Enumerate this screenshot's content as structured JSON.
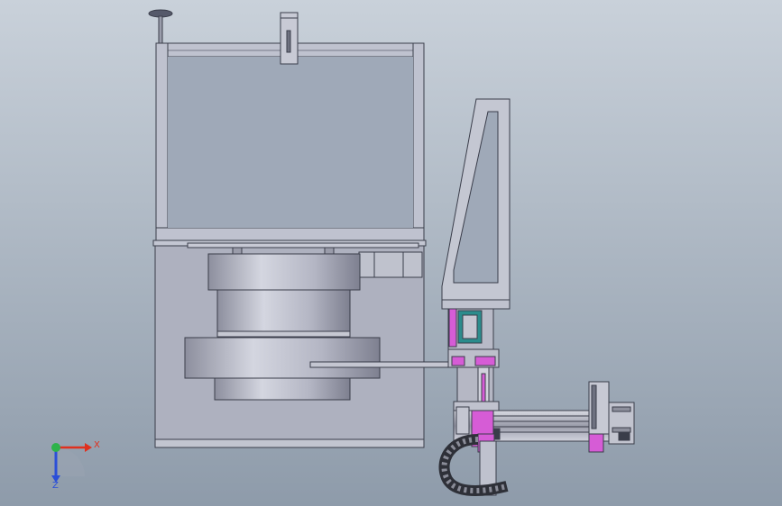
{
  "viewport": {
    "background_top": "#C9D1DA",
    "background_bottom": "#8E9BAA"
  },
  "triad": {
    "x_label": "X",
    "z_label": "Z",
    "x_color": "#E0301E",
    "y_color": "#2DB34A",
    "z_color": "#2B4FD8"
  },
  "colors": {
    "frame_fill": "#B9BCC9",
    "frame_stroke": "#3A3D4A",
    "cabinet_fill": "#A9ADBC",
    "drum_light": "#C9CBD6",
    "accent_magenta": "#D65CD6",
    "accent_teal": "#2B8C8C"
  }
}
